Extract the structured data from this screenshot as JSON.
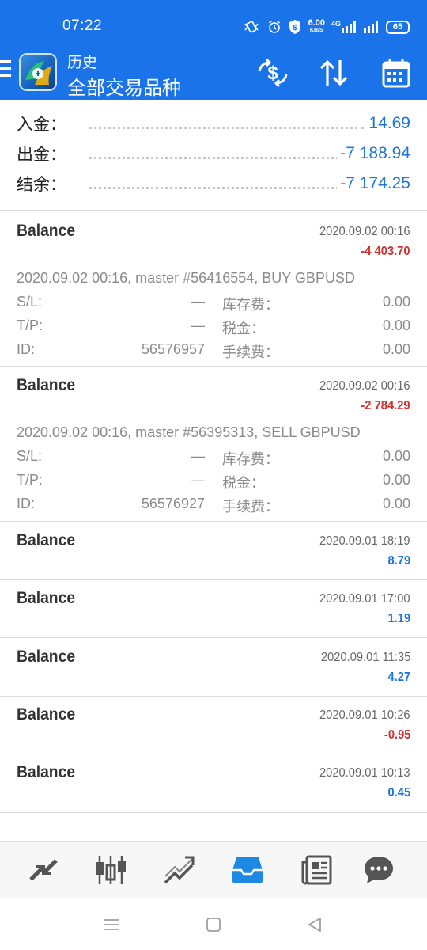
{
  "status_bar": {
    "time": "07:22",
    "net_speed_value": "6.00",
    "net_speed_unit": "KB/S",
    "network": "4G",
    "battery": "65"
  },
  "app_bar": {
    "title": "历史",
    "subtitle": "全部交易品种",
    "accent": "#1a73e8"
  },
  "summary": [
    {
      "label": "入金：",
      "value": "14.69"
    },
    {
      "label": "出金：",
      "value": "-7 188.94"
    },
    {
      "label": "结余：",
      "value": "-7 174.25"
    }
  ],
  "entries": [
    {
      "title": "Balance",
      "date": "2020.09.02 00:16",
      "profit": "-4 403.70",
      "profit_sign": "neg",
      "comment": "2020.09.02 00:16, master #56416554, BUY GBPUSD",
      "details": [
        {
          "k1": "S/L:",
          "v1": "—",
          "k2": "库存费：",
          "v2": "0.00"
        },
        {
          "k1": "T/P:",
          "v1": "—",
          "k2": "税金：",
          "v2": "0.00"
        },
        {
          "k1": "ID:",
          "v1": "56576957",
          "k2": "手续费：",
          "v2": "0.00"
        }
      ]
    },
    {
      "title": "Balance",
      "date": "2020.09.02 00:16",
      "profit": "-2 784.29",
      "profit_sign": "neg",
      "comment": "2020.09.02 00:16, master #56395313, SELL GBPUSD",
      "details": [
        {
          "k1": "S/L:",
          "v1": "—",
          "k2": "库存费：",
          "v2": "0.00"
        },
        {
          "k1": "T/P:",
          "v1": "—",
          "k2": "税金：",
          "v2": "0.00"
        },
        {
          "k1": "ID:",
          "v1": "56576927",
          "k2": "手续费：",
          "v2": "0.00"
        }
      ]
    },
    {
      "title": "Balance",
      "date": "2020.09.01 18:19",
      "profit": "8.79",
      "profit_sign": "pos"
    },
    {
      "title": "Balance",
      "date": "2020.09.01 17:00",
      "profit": "1.19",
      "profit_sign": "pos"
    },
    {
      "title": "Balance",
      "date": "2020.09.01 11:35",
      "profit": "4.27",
      "profit_sign": "pos"
    },
    {
      "title": "Balance",
      "date": "2020.09.01 10:26",
      "profit": "-0.95",
      "profit_sign": "neg"
    },
    {
      "title": "Balance",
      "date": "2020.09.01 10:13",
      "profit": "0.45",
      "profit_sign": "pos"
    }
  ],
  "bottom_nav": [
    {
      "icon": "quotes-icon",
      "active": false
    },
    {
      "icon": "chart-candles-icon",
      "active": false
    },
    {
      "icon": "trade-icon",
      "active": false
    },
    {
      "icon": "history-inbox-icon",
      "active": true
    },
    {
      "icon": "news-icon",
      "active": false
    },
    {
      "icon": "chat-icon",
      "active": false
    }
  ],
  "colors": {
    "positive": "#1e74d8",
    "negative": "#d32f2f",
    "nav_inactive": "#555555",
    "nav_active": "#1e88e5"
  }
}
